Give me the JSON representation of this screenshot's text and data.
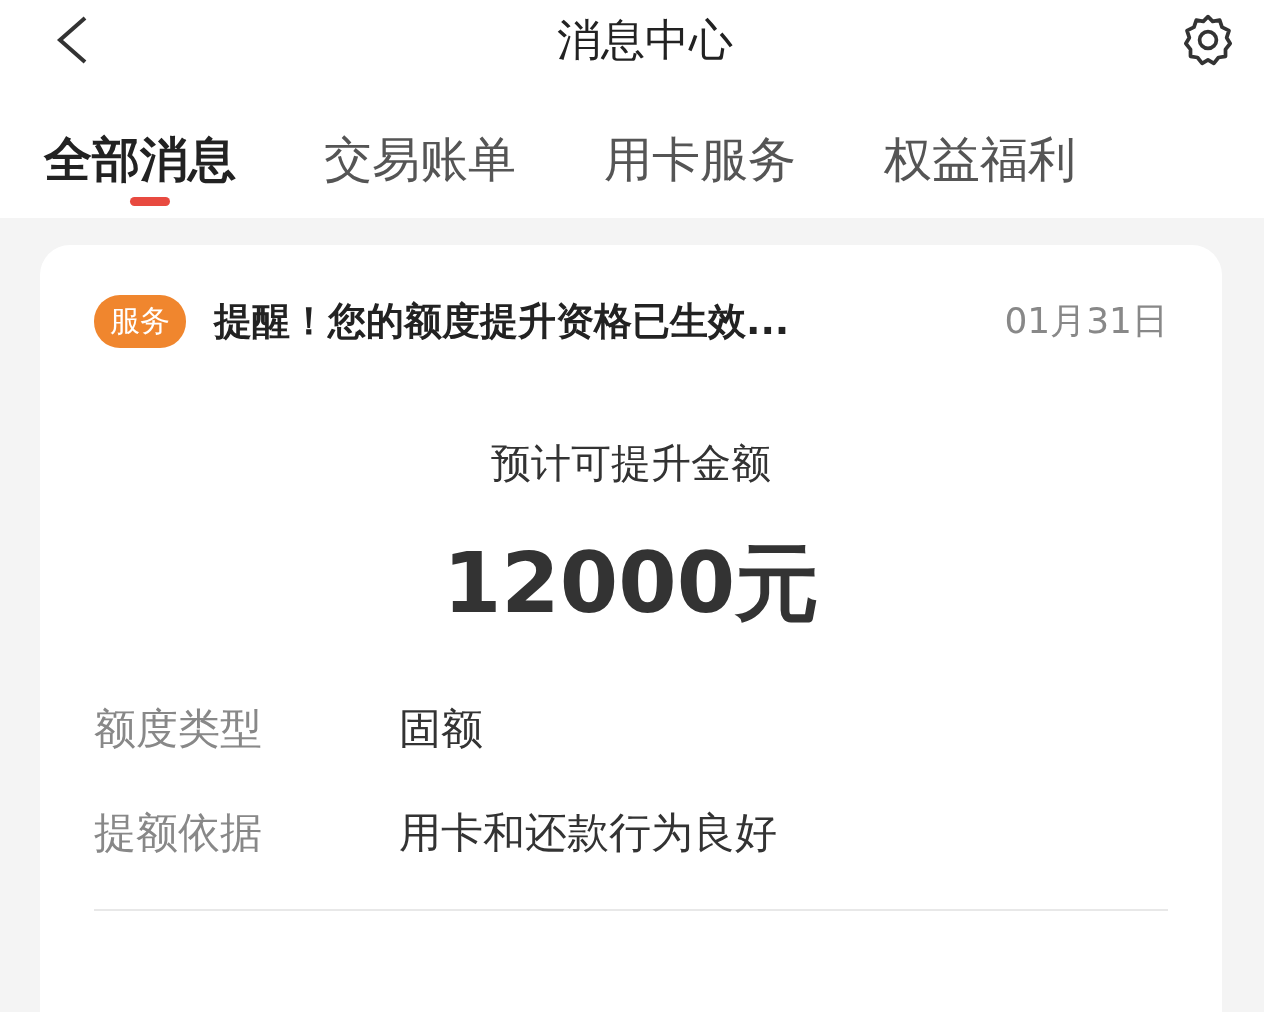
{
  "header": {
    "title": "消息中心"
  },
  "tabs": [
    {
      "label": "全部消息",
      "selected": true
    },
    {
      "label": "交易账单",
      "selected": false
    },
    {
      "label": "用卡服务",
      "selected": false
    },
    {
      "label": "权益福利",
      "selected": false
    }
  ],
  "message": {
    "badge": "服务",
    "title": "提醒！您的额度提升资格已生效...",
    "date": "01月31日",
    "amount_label": "预计可提升金额",
    "amount": "12000元",
    "details": [
      {
        "label": "额度类型",
        "value": "固额"
      },
      {
        "label": "提额依据",
        "value": "用卡和还款行为良好"
      }
    ]
  }
}
